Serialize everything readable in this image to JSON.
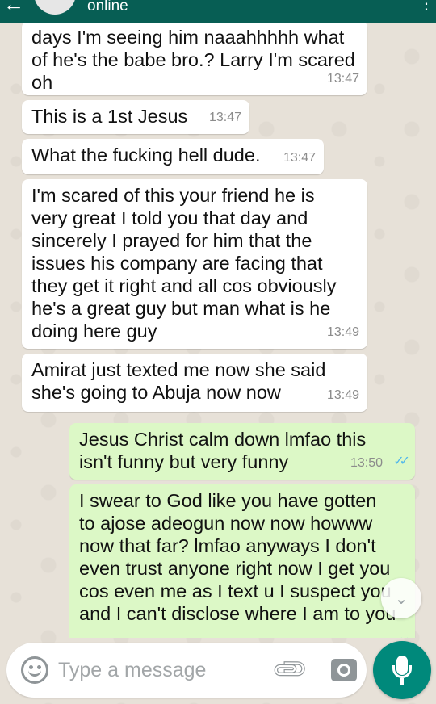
{
  "header": {
    "status": "online",
    "back_icon": "arrow-back-icon",
    "colors": {
      "bar": "#075e54"
    }
  },
  "messages": [
    {
      "direction": "in",
      "text": "days I'm seeing him naaahhhhh what\nof he's the babe bro.? Larry I'm scared\noh",
      "time": "13:47"
    },
    {
      "direction": "in",
      "text": "This is a 1st Jesus",
      "time": "13:47"
    },
    {
      "direction": "in",
      "text": "What the fucking hell dude.",
      "time": "13:47"
    },
    {
      "direction": "in",
      "text": "I'm scared of this your friend he is\nvery great I told you that day and\nsincerely I prayed for him that the\nissues his company are facing that\nthey get it right and all cos obviously\nhe's a great guy but man what is he\ndoing here guy",
      "time": "13:49"
    },
    {
      "direction": "in",
      "text": "Amirat just texted me now she said\nshe's going to Abuja now now",
      "time": "13:49"
    },
    {
      "direction": "out",
      "text": "Jesus Christ calm down lmfao this\nisn't funny but very funny",
      "time": "13:50",
      "read": true
    },
    {
      "direction": "out",
      "text": "I swear to God like you have gotten\nto ajose adeogun now now howww\nnow that far? lmfao anyways I don't\neven trust anyone right now I get you\ncos even me as I text u I suspect you\nand I can't disclose where I am to you",
      "time": "",
      "read": true
    }
  ],
  "composer": {
    "placeholder": "Type a message",
    "emoji_icon": "emoji-icon",
    "attach_icon": "paperclip-icon",
    "camera_icon": "camera-icon",
    "mic_icon": "microphone-icon"
  },
  "colors": {
    "incoming": "#ffffff",
    "outgoing": "#dcf8c6",
    "read_ticks": "#4fb6ec",
    "mic_button": "#00897b"
  }
}
